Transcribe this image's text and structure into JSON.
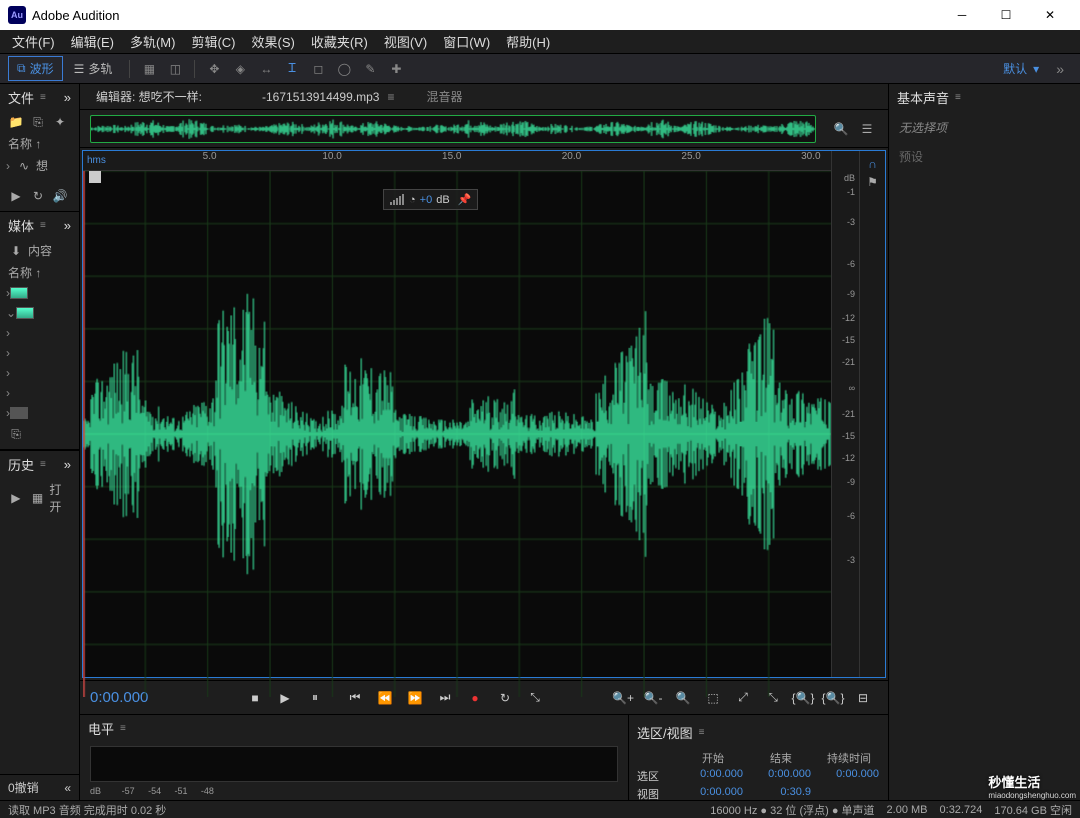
{
  "app": {
    "title": "Adobe Audition",
    "logo_text": "Au"
  },
  "menubar": [
    "文件(F)",
    "编辑(E)",
    "多轨(M)",
    "剪辑(C)",
    "效果(S)",
    "收藏夹(R)",
    "视图(V)",
    "窗口(W)",
    "帮助(H)"
  ],
  "toolbar": {
    "waveform": "波形",
    "multitrack": "多轨",
    "workspace": "默认"
  },
  "left": {
    "files_panel": "文件",
    "name_header": "名称 ↑",
    "file_short": "想",
    "media_panel": "媒体",
    "media_sub": "内容",
    "media_name_header": "名称 ↑",
    "history_panel": "历史",
    "history_action": "打开"
  },
  "editor": {
    "tab_prefix": "编辑器: 想吃不一样:",
    "tab_filename": "-1671513914499.mp3",
    "mixer_tab": "混音器",
    "ruler_unit": "hms",
    "ruler_ticks": [
      "5.0",
      "10.0",
      "15.0",
      "20.0",
      "25.0",
      "30.0"
    ],
    "db_scale_top": [
      "dB",
      "-1",
      "",
      "-3",
      "",
      "-6",
      "-9",
      "-12",
      "-15",
      "-21",
      "∞"
    ],
    "db_scale_bottom": [
      "-21",
      "-15",
      "-12",
      "-9",
      "",
      "-6",
      "",
      "-3",
      ""
    ],
    "hud_db": "+0",
    "hud_db_unit": "dB",
    "timecode": "0:00.000"
  },
  "right": {
    "panel_title": "基本声音",
    "no_selection": "无选择项",
    "preset_label": "预设"
  },
  "levels": {
    "panel_title": "电平",
    "ticks": [
      "dB",
      "-57",
      "-54",
      "-51",
      "-48"
    ]
  },
  "selection": {
    "panel_title": "选区/视图",
    "headers": [
      "开始",
      "结束",
      "持续时间"
    ],
    "rows": [
      {
        "label": "选区",
        "start": "0:00.000",
        "end": "0:00.000",
        "dur": "0:00.000"
      },
      {
        "label": "视图",
        "start": "0:00.000",
        "end": "0:30.9",
        "dur": ""
      }
    ]
  },
  "status": {
    "left": "读取 MP3 音频 完成用时 0.02 秒",
    "sample_rate": "16000 Hz",
    "bit_depth": "32 位 (浮点)",
    "channels": "单声道",
    "size": "2.00 MB",
    "duration": "0:32.724",
    "disk": "170.64 GB 空闲"
  },
  "undo_label": "0撤销",
  "watermark": {
    "main": "秒懂生活",
    "sub": "miaodongshenghuo.com"
  },
  "chart_data": {
    "type": "waveform",
    "duration_seconds": 30.9,
    "y_scale": "dB",
    "y_ticks": [
      -1,
      -3,
      -6,
      -9,
      -12,
      -15,
      -21
    ],
    "note": "Mono audio waveform amplitude envelope; dense speech/music signal spanning full duration with peaks near -1 dB and typical body around -12 to -21 dB."
  }
}
